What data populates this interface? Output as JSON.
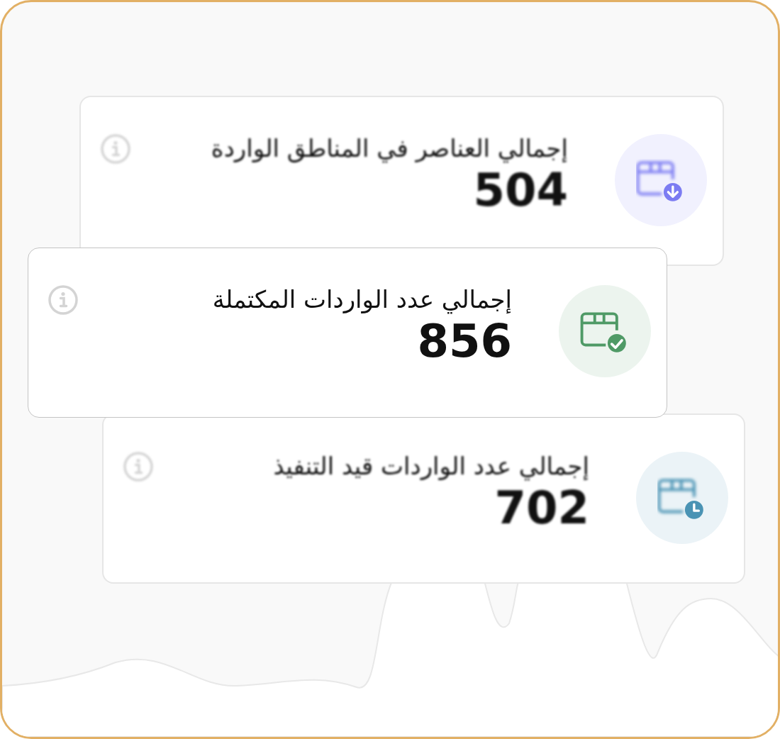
{
  "cards": [
    {
      "title": "إجمالي العناصر في المناطق الواردة",
      "value": "504",
      "kind": "download",
      "color": "#7c7cf2",
      "focused": false
    },
    {
      "title": "إجمالي عدد الواردات المكتملة",
      "value": "856",
      "kind": "check",
      "color": "#4f9a66",
      "focused": true
    },
    {
      "title": "إجمالي عدد الواردات قيد التنفيذ",
      "value": "702",
      "kind": "clock",
      "color": "#4a93b4",
      "focused": false
    }
  ]
}
